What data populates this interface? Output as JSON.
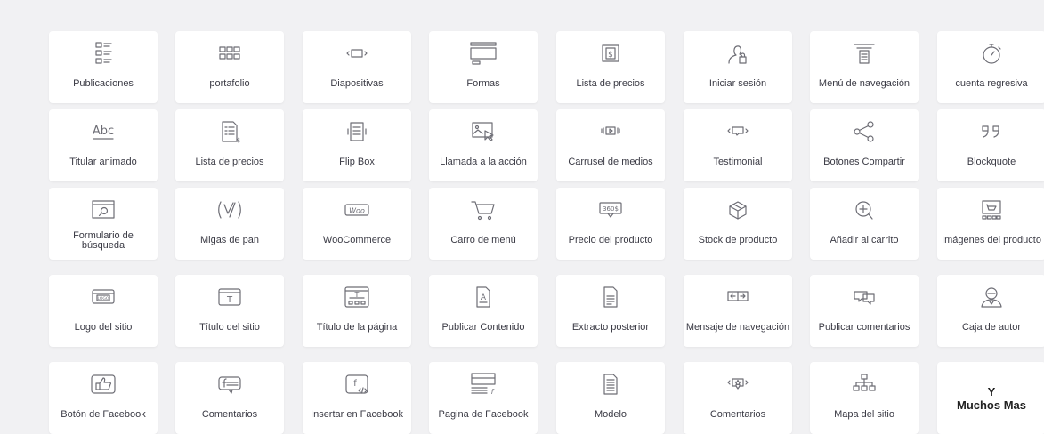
{
  "widgets": [
    {
      "label": "Publicaciones",
      "icon": "posts-icon"
    },
    {
      "label": "portafolio",
      "icon": "portfolio-icon"
    },
    {
      "label": "Diapositivas",
      "icon": "slides-icon"
    },
    {
      "label": "Formas",
      "icon": "forms-icon"
    },
    {
      "label": "Lista de precios",
      "icon": "price-table-icon"
    },
    {
      "label": "Iniciar sesión",
      "icon": "login-icon"
    },
    {
      "label": "Menú de navegación",
      "icon": "nav-menu-icon"
    },
    {
      "label": "cuenta regresiva",
      "icon": "countdown-icon"
    },
    {
      "label": "Titular animado",
      "icon": "animated-headline-icon",
      "icon_text": "Abc"
    },
    {
      "label": "Lista de precios",
      "icon": "price-list-icon"
    },
    {
      "label": "Flip Box",
      "icon": "flip-box-icon"
    },
    {
      "label": "Llamada a la acción",
      "icon": "call-to-action-icon"
    },
    {
      "label": "Carrusel de medios",
      "icon": "media-carousel-icon"
    },
    {
      "label": "Testimonial",
      "icon": "testimonial-icon"
    },
    {
      "label": "Botones Compartir",
      "icon": "share-buttons-icon"
    },
    {
      "label": "Blockquote",
      "icon": "blockquote-icon"
    },
    {
      "label": "Formulario de búsqueda",
      "icon": "search-form-icon"
    },
    {
      "label": "Migas de pan",
      "icon": "breadcrumbs-icon"
    },
    {
      "label": "WooCommerce",
      "icon": "woocommerce-icon",
      "icon_text": "Woo"
    },
    {
      "label": "Carro de menú",
      "icon": "menu-cart-icon"
    },
    {
      "label": "Precio del producto",
      "icon": "product-price-icon",
      "icon_text": "360$"
    },
    {
      "label": "Stock de producto",
      "icon": "product-stock-icon"
    },
    {
      "label": "Añadir al carrito",
      "icon": "add-to-cart-icon"
    },
    {
      "label": "Imágenes del producto",
      "icon": "product-images-icon"
    },
    {
      "label": "Logo del sitio",
      "icon": "site-logo-icon",
      "icon_text": "LOGO"
    },
    {
      "label": "Título del sitio",
      "icon": "site-title-icon",
      "icon_text": "T"
    },
    {
      "label": "Título de la página",
      "icon": "page-title-icon",
      "icon_text": "T"
    },
    {
      "label": "Publicar Contenido",
      "icon": "post-content-icon"
    },
    {
      "label": "Extracto posterior",
      "icon": "post-excerpt-icon"
    },
    {
      "label": "Mensaje de navegación",
      "icon": "post-navigation-icon"
    },
    {
      "label": "Publicar comentarios",
      "icon": "post-comments-icon"
    },
    {
      "label": "Caja de autor",
      "icon": "author-box-icon"
    },
    {
      "label": "Botón de Facebook",
      "icon": "facebook-button-icon"
    },
    {
      "label": "Comentarios",
      "icon": "facebook-comments-icon"
    },
    {
      "label": "Insertar en Facebook",
      "icon": "facebook-embed-icon",
      "icon_text": "f"
    },
    {
      "label": "Pagina de Facebook",
      "icon": "facebook-page-icon",
      "icon_text": "f"
    },
    {
      "label": "Modelo",
      "icon": "template-icon"
    },
    {
      "label": "Comentarios",
      "icon": "comments-icon"
    },
    {
      "label": "Mapa del sitio",
      "icon": "sitemap-icon"
    },
    {
      "label": "Y\nMuchos Mas",
      "icon": "",
      "more": true
    }
  ],
  "colors": {
    "background": "#f1f1f3",
    "card": "#ffffff",
    "icon": "#6d6d75",
    "text": "#3a3a44"
  }
}
